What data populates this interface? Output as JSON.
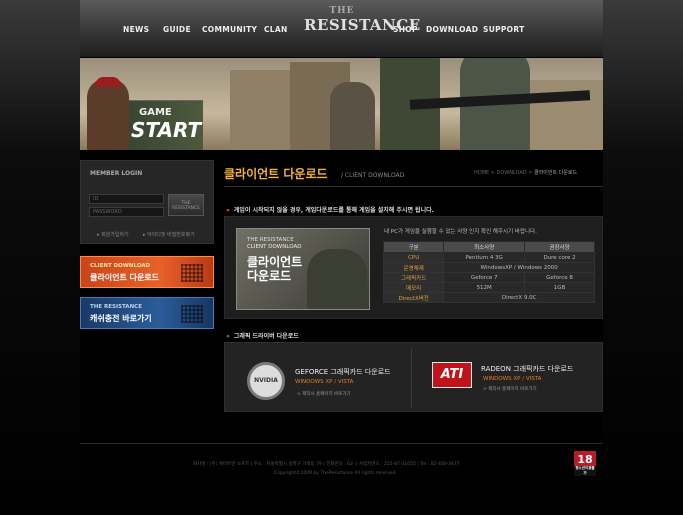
{
  "nav": {
    "items": [
      "NEWS",
      "GUIDE",
      "COMMUNITY",
      "CLAN",
      "SHOP",
      "DOWNLOAD",
      "SUPPORT"
    ],
    "logo_top": "THE",
    "logo_main": "RESISTANCE"
  },
  "hero": {
    "gamestart_top": "GAME",
    "gamestart_main": "START"
  },
  "login": {
    "title": "MEMBER LOGIN",
    "id_placeholder": "ID",
    "pw_placeholder": "PASSWORD",
    "button": "THE RESISTANCE",
    "link1": "회원가입하기",
    "link2": "아이디및 비밀번호찾기"
  },
  "banners": {
    "client_top": "CLIENT DOWNLOAD",
    "client_main": "클라이언트 다운로드",
    "cash_top": "THE RESISTANCE",
    "cash_main": "캐쉬충전 바로가기"
  },
  "content": {
    "title": "클라이언트 다운로드",
    "subtitle": "/ CLIENT DOWNLOAD",
    "breadcrumb_home": "HOME > DOWNLOAD >",
    "breadcrumb_current": "클라이언트 다운로드",
    "notice": "게임이 시작되지 않을 경우, 게임다운로드를 통해 게임을 설치해 주시면 됩니다.",
    "download_top": "THE RESISTANCE",
    "download_sub": "CLIENT DOWNLOAD",
    "download_main": "클라이언트 다운로드",
    "sys_note": "내 PC가 게임을 실행할 수 있는 사양 인지 확인 해주시기 바랍니다.",
    "spec_headers": [
      "구분",
      "최소사양",
      "권장사양"
    ],
    "spec_rows": [
      {
        "label": "CPU",
        "min": "Pentium 4 3G",
        "rec": "Dure core 2"
      },
      {
        "label": "운영체제",
        "min": "WindowsXP / Windows 2000",
        "rec": ""
      },
      {
        "label": "그래픽카드",
        "min": "Geforce 7",
        "rec": "Geforce 8"
      },
      {
        "label": "메모리",
        "min": "512M",
        "rec": "1GB"
      },
      {
        "label": "DirectX버전",
        "min": "DirectX 9.0C",
        "rec": ""
      }
    ],
    "gpu_section": "그래픽 드라이버 다운로드",
    "nvidia_title": "GEFORCE 그래픽카드 다운로드",
    "nvidia_os": "WINDOWS XP  /  VISTA",
    "nvidia_link": "> 제작사 홈페이지 바로가기",
    "nvidia_logo": "NVIDIA",
    "ati_title": "RADEON 그래픽카드 다운로드",
    "ati_os": "WINDOWS XP  /  VISTA",
    "ati_link": "> 제작사 홈페이지 바로가기",
    "ati_logo": "ATI"
  },
  "footer": {
    "address": "회사명 : (주) 메이트엔 소프트  |  주소 : 서울특별시 송파구 가락동 79  |  전화번호 : 02-  |  사업자번호 : 215-87-31055  |  Tel : 02-400-3477",
    "copyright": "Copyright©2009 by TheResistance All rights reserved.",
    "rating": "18",
    "rating_text": "청소년이용불가"
  }
}
